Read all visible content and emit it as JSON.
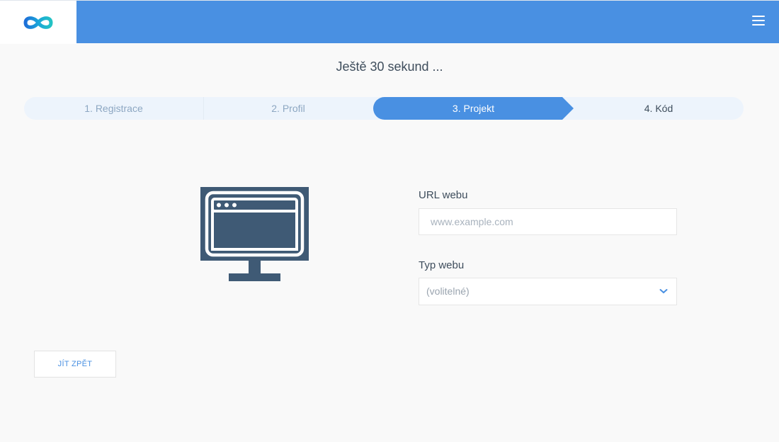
{
  "header": {
    "logo_icon": "infinity-logo-icon",
    "menu_icon": "hamburger-menu-icon",
    "brand_color": "#4990e2"
  },
  "page": {
    "title": "Ještě 30 sekund ..."
  },
  "steps": [
    {
      "label": "1. Registrace",
      "state": "done"
    },
    {
      "label": "2. Profil",
      "state": "done"
    },
    {
      "label": "3. Projekt",
      "state": "active"
    },
    {
      "label": "4. Kód",
      "state": "upcoming"
    }
  ],
  "form": {
    "illustration_icon": "monitor-browser-icon",
    "url_label": "URL webu",
    "url_placeholder": "www.example.com",
    "url_value": "",
    "type_label": "Typ webu",
    "type_selected": "(volitelné)"
  },
  "actions": {
    "back_label": "JÍT ZPĚT"
  }
}
